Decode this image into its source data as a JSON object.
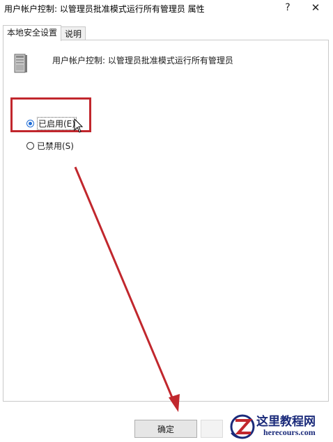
{
  "window": {
    "title": "用户帐户控制: 以管理员批准模式运行所有管理员 属性",
    "help_glyph": "?",
    "close_glyph": "✕"
  },
  "tabs": [
    {
      "label": "本地安全设置",
      "active": true
    },
    {
      "label": "说明",
      "active": false
    }
  ],
  "policy": {
    "icon": "computer-tower-icon",
    "name": "用户帐户控制: 以管理员批准模式运行所有管理员"
  },
  "options": {
    "enabled": {
      "label": "已启用(E)",
      "checked": true
    },
    "disabled": {
      "label": "已禁用(S)",
      "checked": false
    }
  },
  "buttons": {
    "ok_label": "确定"
  },
  "watermark": {
    "title": "这里教程网",
    "url": "herecours.com"
  },
  "colors": {
    "annotation_red": "#c1272d",
    "radio_blue": "#1e6cd6",
    "watermark_blue": "#1a2a7a"
  }
}
